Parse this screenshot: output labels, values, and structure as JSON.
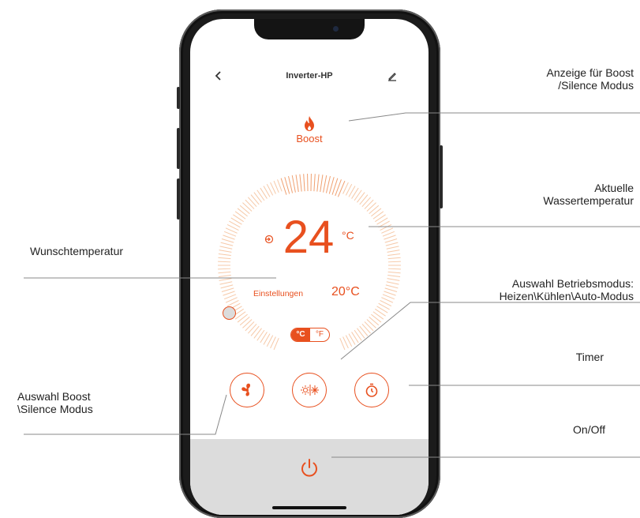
{
  "app": {
    "title": "Inverter-HP",
    "back_icon": "chevron-left-icon",
    "edit_icon": "pencil-icon"
  },
  "mode_indicator": {
    "icon": "flame-icon",
    "label": "Boost"
  },
  "current_temperature": {
    "value": "24",
    "unit": "°C",
    "icon": "arrow-in-icon"
  },
  "setpoint": {
    "label": "Einstellungen",
    "value": "20",
    "unit": "°C"
  },
  "unit_toggle": {
    "celsius": "°C",
    "fahrenheit": "°F",
    "selected": "°C"
  },
  "controls": [
    {
      "name": "boost-silence-button",
      "icon": "fan-icon"
    },
    {
      "name": "mode-button",
      "icon": "sun-snowflake-icon"
    },
    {
      "name": "timer-button",
      "icon": "timer-icon"
    }
  ],
  "power": {
    "icon": "power-icon"
  },
  "annotations": {
    "boost_display": [
      "Anzeige für Boost",
      "/Silence Modus"
    ],
    "water_temp": [
      "Aktuelle",
      "Wassertemperatur"
    ],
    "setpoint": [
      "Wunschtemperatur"
    ],
    "mode_select": [
      "Auswahl Betriebsmodus:",
      "Heizen\\Kühlen\\Auto-Modus"
    ],
    "timer": [
      "Timer"
    ],
    "boost_select": [
      "Auswahl Boost",
      "\\Silence Modus"
    ],
    "onoff": [
      "On/Off"
    ]
  },
  "colors": {
    "accent": "#e8501f",
    "dial_light": "#f6c9a8",
    "panel": "#dcdcdc",
    "phone": "#1b1b1b"
  }
}
